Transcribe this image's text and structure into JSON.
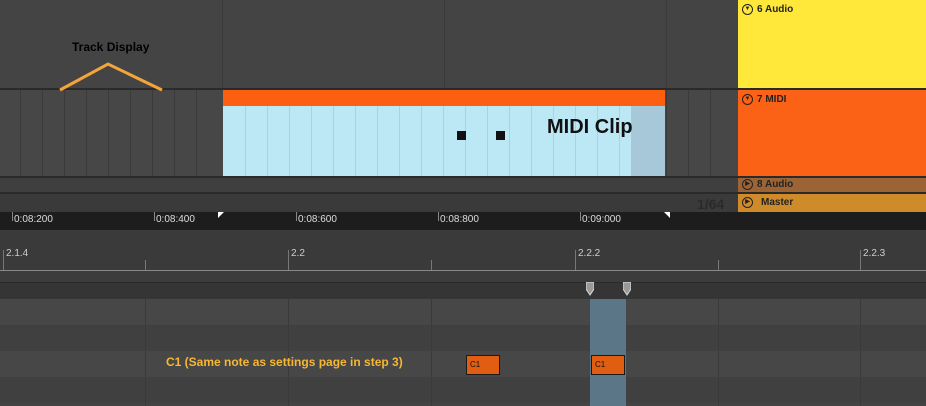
{
  "annotations": {
    "track_display": "Track Display",
    "midi_clip": "MIDI Clip",
    "c1_note": "C1 (Same note as settings page in step 3)"
  },
  "tracks": [
    {
      "name": "6 Audio",
      "color": "#ffe83a"
    },
    {
      "name": "7 MIDI",
      "color": "#fb6216"
    },
    {
      "name": "8 Audio",
      "color": "#9c6434"
    },
    {
      "name": "Master",
      "color": "#cf8a2a"
    }
  ],
  "zoom_grid": "1/64",
  "time_ruler": [
    "0:08:200",
    "0:08:400",
    "0:08:600",
    "0:08:800",
    "0:09:000"
  ],
  "beat_ruler": [
    "2.1.4",
    "2.2",
    "2.2.2",
    "2.2.3"
  ],
  "notes": [
    {
      "label": "C1"
    },
    {
      "label": "C1"
    }
  ],
  "colors": {
    "clip_bar": "#fb5f0f",
    "clip_body": "#bce8f6",
    "annotation": "#f7b731",
    "note": "#e05d12"
  }
}
